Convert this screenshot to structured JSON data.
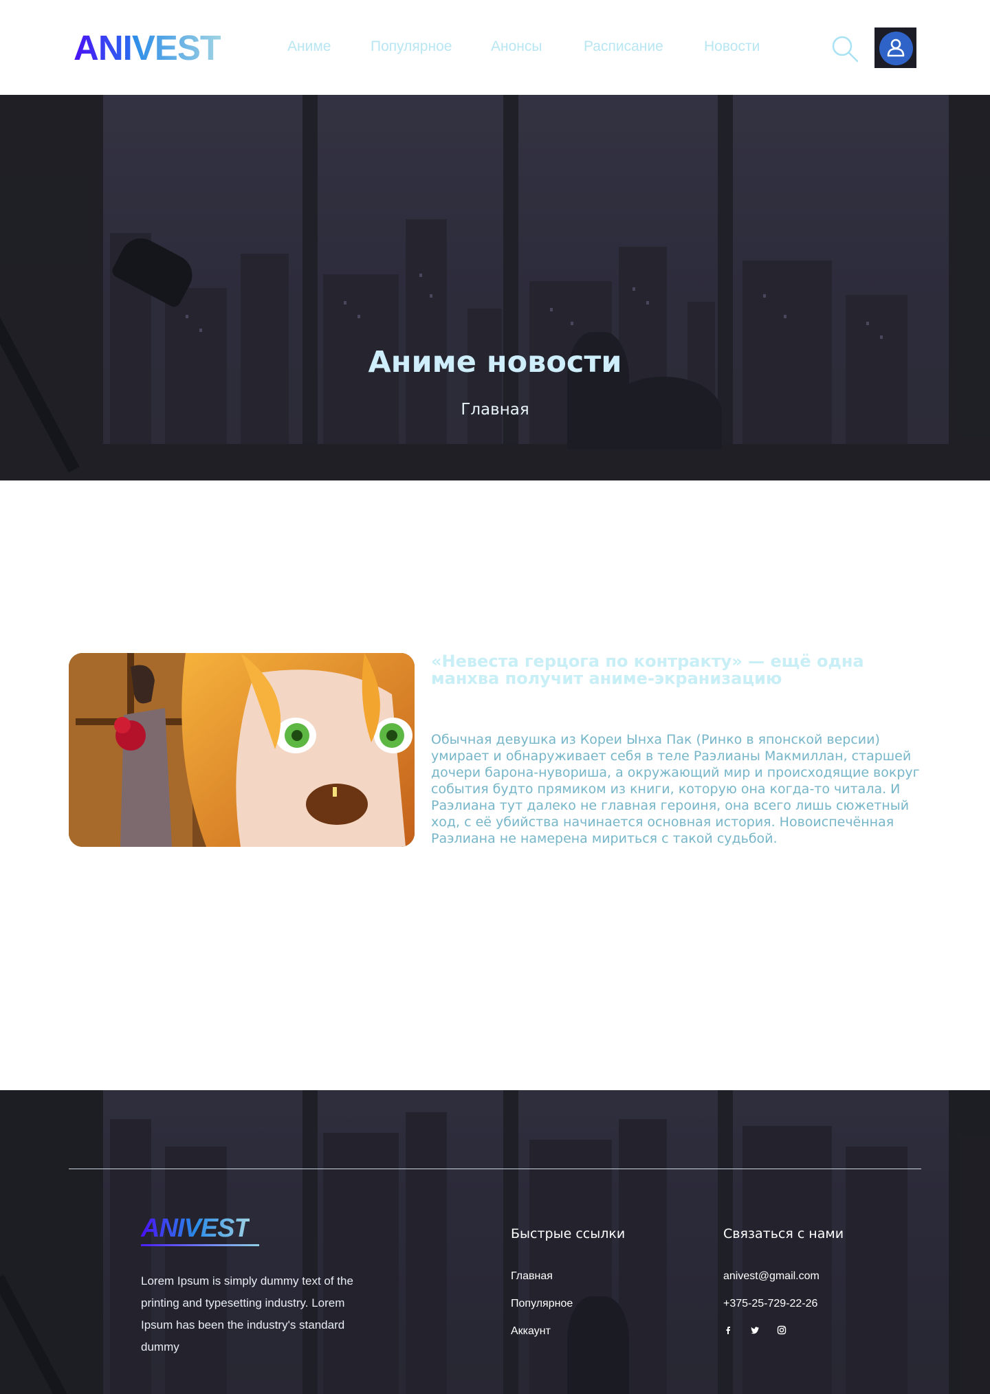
{
  "header": {
    "logo": {
      "part1": "ANI",
      "part2": "VEST"
    },
    "nav": [
      {
        "label": "Аниме"
      },
      {
        "label": "Популярное"
      },
      {
        "label": "Анонсы"
      },
      {
        "label": "Расписание"
      },
      {
        "label": "Новости"
      }
    ],
    "icons": {
      "search": "search-icon",
      "user": "user-icon"
    }
  },
  "hero": {
    "title": "Аниме новости",
    "breadcrumb": "Главная"
  },
  "article": {
    "title": "«Невеста герцога по контракту» — ещё одна манхва получит аниме-экранизацию",
    "text": "Обычная девушка из Кореи Ынха Пак (Ринко в японской версии) умирает и обнаруживает себя в теле Раэлианы Макмиллан, старшей дочери барона-нувориша, а окружающий мир и происходящие вокруг события будто прямиком из книги, которую она когда-то читала. И Раэлиана тут далеко не главная героиня, она всего лишь сюжетный ход, с её убийства начинается основная история. Новоиспечённая Раэлиана не намерена мириться с такой судьбой."
  },
  "footer": {
    "logo": "ANIVEST",
    "about": "Lorem Ipsum is simply dummy text of the printing and typesetting industry. Lorem Ipsum has been the industry's standard dummy",
    "quick_links": {
      "title": "Быстрые ссылки",
      "items": [
        "Главная",
        "Популярное",
        "Аккаунт"
      ]
    },
    "contact": {
      "title": "Связаться с нами",
      "email": "anivest@gmail.com",
      "phone": "+375-25-729-22-26",
      "socials": [
        "facebook-icon",
        "twitter-icon",
        "instagram-icon"
      ]
    }
  },
  "colors": {
    "logo_gradient": [
      "#4a10f5",
      "#2a8be8",
      "#9fd3e3"
    ],
    "nav_text": "#b8e6f2",
    "article_title": "#c8eef6",
    "article_text": "#76b6c8",
    "scene_bg": "#2c2c38"
  }
}
